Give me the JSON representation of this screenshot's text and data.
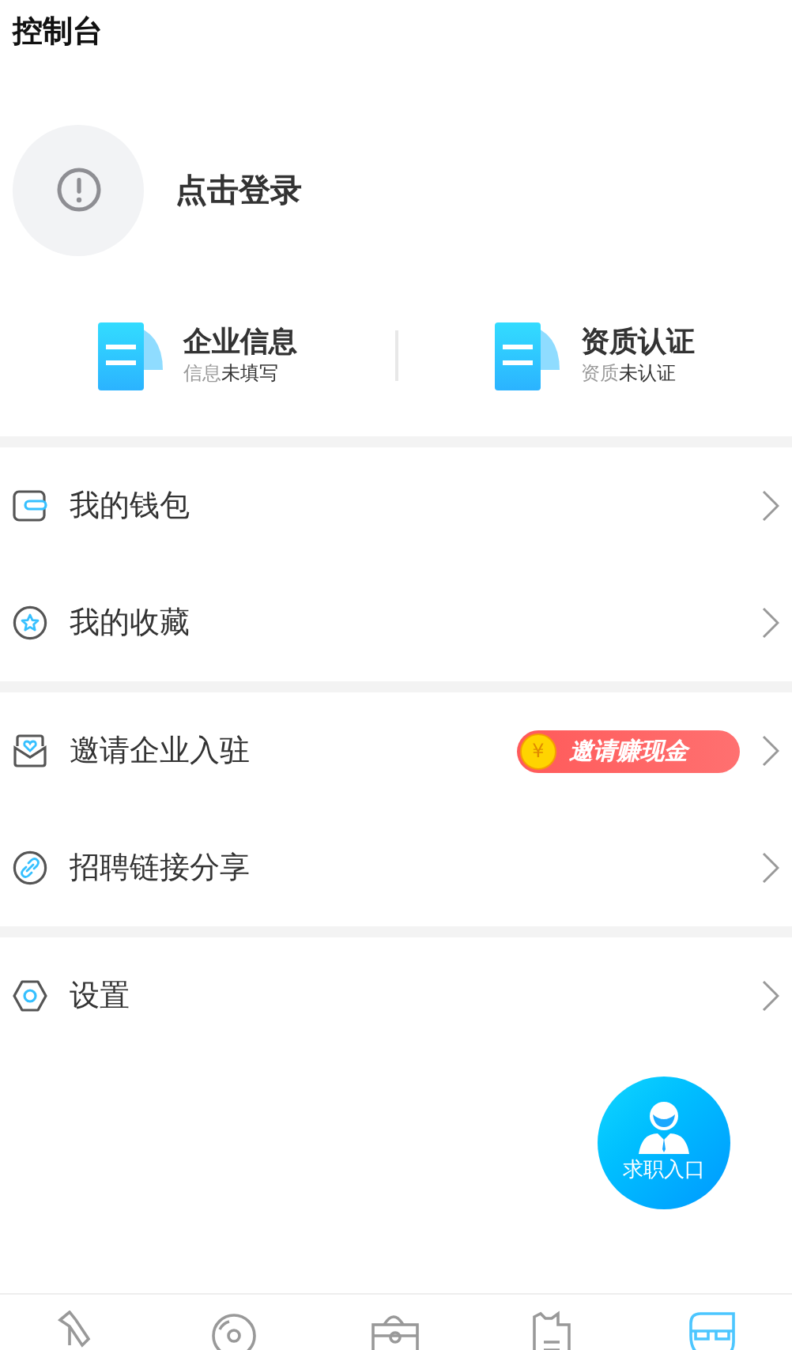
{
  "header": {
    "title": "控制台"
  },
  "profile": {
    "login_label": "点击登录"
  },
  "info_cards": [
    {
      "title": "企业信息",
      "status_prefix": "信息",
      "status": "未填写"
    },
    {
      "title": "资质认证",
      "status_prefix": "资质",
      "status": "未认证"
    }
  ],
  "menu_groups": [
    [
      {
        "label": "我的钱包"
      },
      {
        "label": "我的收藏"
      }
    ],
    [
      {
        "label": "邀请企业入驻",
        "badge": "邀请赚现金",
        "badge_coin": "¥"
      },
      {
        "label": "招聘链接分享"
      }
    ],
    [
      {
        "label": "设置"
      }
    ]
  ],
  "floating_button": {
    "label": "求职入口"
  },
  "bottom_nav": [
    {
      "selected": false
    },
    {
      "selected": false
    },
    {
      "selected": false
    },
    {
      "selected": false
    },
    {
      "selected": true
    }
  ]
}
